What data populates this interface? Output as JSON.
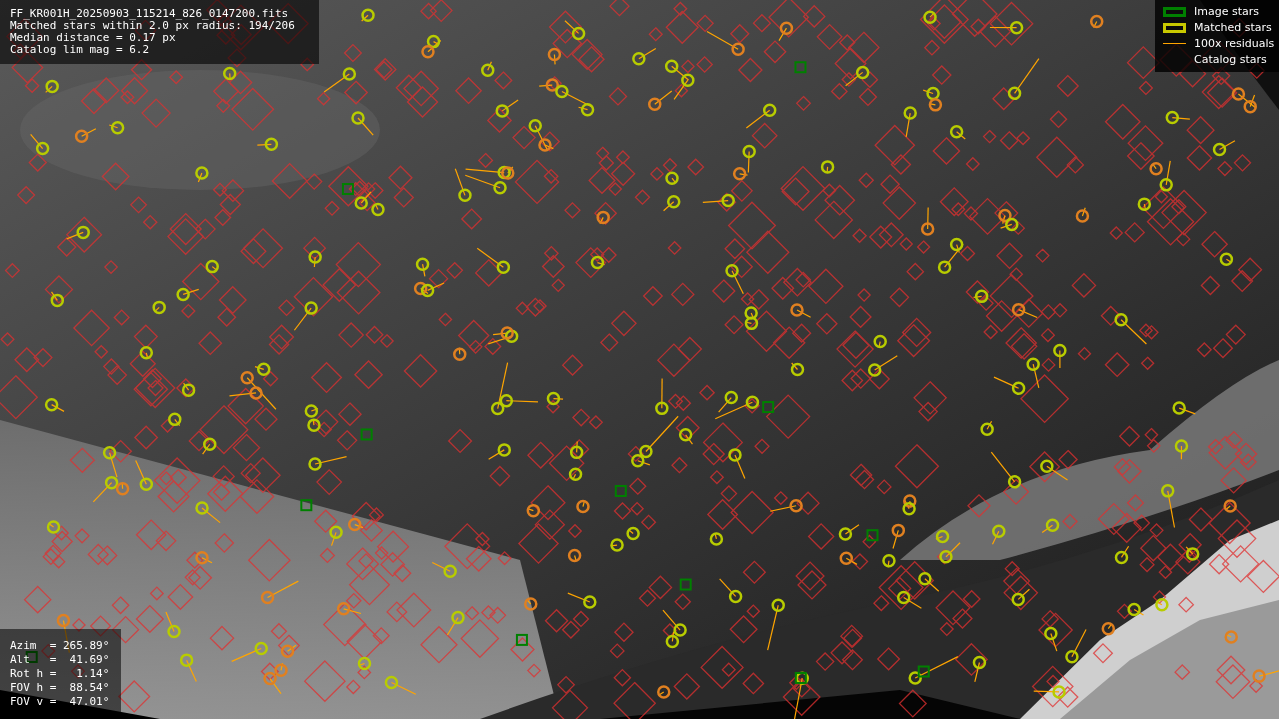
{
  "info_box": {
    "lines": [
      "FF_KR001H_20250903_115214_826_0147200.fits",
      "Matched stars within 2.0 px radius: 194/206",
      "Median distance = 0.17 px",
      "Catalog lim mag = 6.2"
    ]
  },
  "legend": [
    {
      "kind": "box",
      "color": "#008000",
      "label": "Image stars"
    },
    {
      "kind": "box",
      "color": "#c8c800",
      "label": "Matched stars"
    },
    {
      "kind": "line",
      "color": "#ffa500",
      "label": "100x residuals"
    },
    {
      "kind": "none",
      "label": "Catalog stars"
    }
  ],
  "pointing_box": {
    "lines": [
      "Azim  = 265.89°",
      "Alt   =  41.69°",
      "Rot h =   1.14°",
      "FOV h =  88.54°",
      "FOV v =  47.01°"
    ]
  }
}
